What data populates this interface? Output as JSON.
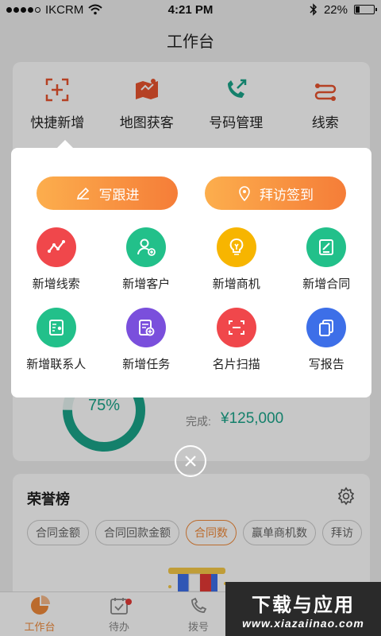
{
  "status_bar": {
    "carrier": "IKCRM",
    "time": "4:21 PM",
    "battery": "22%",
    "battery_level": 0.22
  },
  "page_title": "工作台",
  "quick_actions": [
    {
      "label": "快捷新增",
      "icon": "scan-plus-icon"
    },
    {
      "label": "地图获客",
      "icon": "map-icon"
    },
    {
      "label": "号码管理",
      "icon": "phone-icon"
    },
    {
      "label": "线索",
      "icon": "lead-icon"
    }
  ],
  "popup": {
    "buttons": [
      {
        "label": "写跟进",
        "icon": "pencil-icon"
      },
      {
        "label": "拜访签到",
        "icon": "location-pin-icon"
      }
    ],
    "items": [
      {
        "label": "新增线索",
        "icon": "trend-icon",
        "color": "#f0474b"
      },
      {
        "label": "新增客户",
        "icon": "user-add-icon",
        "color": "#22c08a"
      },
      {
        "label": "新增商机",
        "icon": "lightbulb-icon",
        "color": "#f7b500"
      },
      {
        "label": "新增合同",
        "icon": "contract-icon",
        "color": "#22c08a"
      },
      {
        "label": "新增联系人",
        "icon": "contact-card-icon",
        "color": "#22c08a"
      },
      {
        "label": "新增任务",
        "icon": "task-add-icon",
        "color": "#7a4fdc"
      },
      {
        "label": "名片扫描",
        "icon": "scan-card-icon",
        "color": "#f0474b"
      },
      {
        "label": "写报告",
        "icon": "report-icon",
        "color": "#3d6fe8"
      }
    ]
  },
  "progress": {
    "percent": "75%",
    "value": 0.75,
    "done_label": "完成:",
    "done_value": "¥125,000"
  },
  "honor": {
    "title": "荣誉榜",
    "chips": [
      "合同金额",
      "合同回款金额",
      "合同数",
      "赢单商机数",
      "拜访"
    ],
    "active_chip": "合同数"
  },
  "tabs": [
    {
      "label": "工作台",
      "icon": "dashboard-icon",
      "active": true
    },
    {
      "label": "待办",
      "icon": "calendar-check-icon",
      "badge": true
    },
    {
      "label": "拨号",
      "icon": "phone-dial-icon"
    },
    {
      "label": "",
      "icon": ""
    },
    {
      "label": "",
      "icon": ""
    }
  ],
  "watermark": {
    "big": "下载与应用",
    "small": "www.xiazaiinao.com"
  },
  "colors": {
    "accent": "#f08a3a",
    "teal": "#1aa58a"
  }
}
